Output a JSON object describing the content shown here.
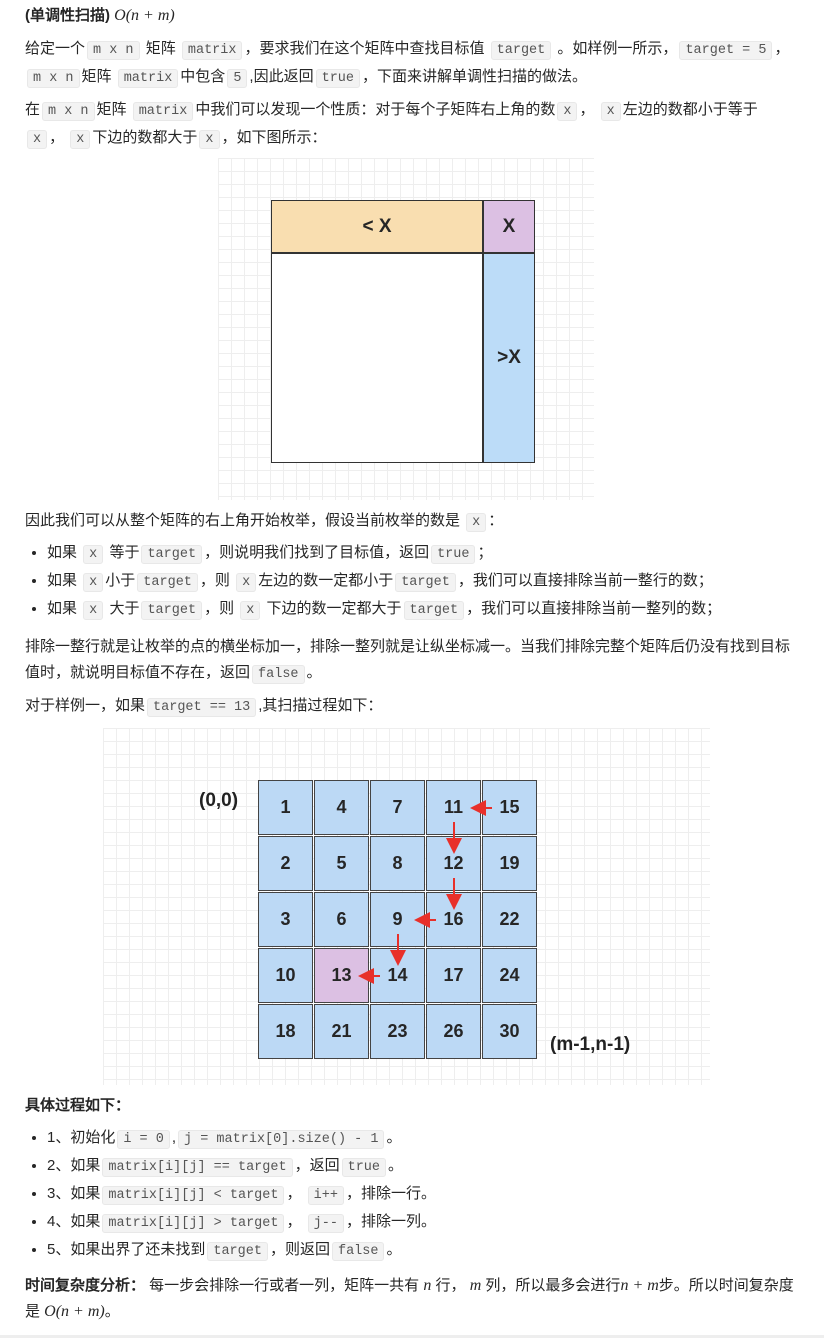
{
  "title": {
    "label": "(单调性扫描)",
    "math": "O(n + m)"
  },
  "p1": [
    {
      "t": "给定一个"
    },
    {
      "c": "m x n"
    },
    {
      "t": " 矩阵 "
    },
    {
      "c": "matrix"
    },
    {
      "t": "，要求我们在这个矩阵中查找目标值 "
    },
    {
      "c": "target"
    },
    {
      "t": " 。如样例一所示，"
    },
    {
      "c": "target = 5"
    },
    {
      "t": "， "
    },
    {
      "c": "m x n"
    },
    {
      "t": "矩阵 "
    },
    {
      "c": "matrix"
    },
    {
      "t": "中包含"
    },
    {
      "c": "5"
    },
    {
      "t": ",因此返回"
    },
    {
      "c": "true"
    },
    {
      "t": "，下面来讲解单调性扫描的做法。"
    }
  ],
  "p2": [
    {
      "t": "在"
    },
    {
      "c": "m x n"
    },
    {
      "t": "矩阵 "
    },
    {
      "c": "matrix"
    },
    {
      "t": "中我们可以发现一个性质：对于每个子矩阵右上角的数"
    },
    {
      "c": "x"
    },
    {
      "t": "， "
    },
    {
      "c": "x"
    },
    {
      "t": "左边的数都小于等于"
    },
    {
      "c": "x"
    },
    {
      "t": "， "
    },
    {
      "c": "x"
    },
    {
      "t": "下边的数都大于"
    },
    {
      "c": "x"
    },
    {
      "t": "，如下图所示："
    }
  ],
  "fig1": {
    "left": "< X",
    "corner": "X",
    "below": ">X",
    "colors": {
      "left": "#f9deb0",
      "corner": "#dcc0e3",
      "below": "#bcdcf8"
    }
  },
  "p3": [
    {
      "t": "因此我们可以从整个矩阵的右上角开始枚举，假设当前枚举的数是 "
    },
    {
      "c": "x"
    },
    {
      "t": "："
    }
  ],
  "list1": [
    [
      {
        "t": "如果 "
      },
      {
        "c": "x"
      },
      {
        "t": " 等于"
      },
      {
        "c": "target"
      },
      {
        "t": "，则说明我们找到了目标值，返回"
      },
      {
        "c": "true"
      },
      {
        "t": "；"
      }
    ],
    [
      {
        "t": "如果 "
      },
      {
        "c": "x"
      },
      {
        "t": "小于"
      },
      {
        "c": "target"
      },
      {
        "t": "，则 "
      },
      {
        "c": "x"
      },
      {
        "t": "左边的数一定都小于"
      },
      {
        "c": "target"
      },
      {
        "t": "，我们可以直接排除当前一整行的数；"
      }
    ],
    [
      {
        "t": "如果 "
      },
      {
        "c": " x"
      },
      {
        "t": " 大于"
      },
      {
        "c": "target"
      },
      {
        "t": "，则 "
      },
      {
        "c": "x"
      },
      {
        "t": " 下边的数一定都大于"
      },
      {
        "c": "target"
      },
      {
        "t": "，我们可以直接排除当前一整列的数；"
      }
    ]
  ],
  "p4": [
    {
      "t": "排除一整行就是让枚举的点的横坐标加一，排除一整列就是让纵坐标减一。当我们排除完整个矩阵后仍没有找到目标值时，就说明目标值不存在，返回"
    },
    {
      "c": "false"
    },
    {
      "t": "。"
    }
  ],
  "p5": [
    {
      "t": "对于样例一，如果"
    },
    {
      "c": "target == 13"
    },
    {
      "t": ",其扫描过程如下："
    }
  ],
  "fig2": {
    "start_label": "(0,0)",
    "end_label": "(m-1,n-1)",
    "matrix": [
      [
        "1",
        "4",
        "7",
        "11",
        "15"
      ],
      [
        "2",
        "5",
        "8",
        "12",
        "19"
      ],
      [
        "3",
        "6",
        "9",
        "16",
        "22"
      ],
      [
        "10",
        "13",
        "14",
        "17",
        "24"
      ],
      [
        "18",
        "21",
        "23",
        "26",
        "30"
      ]
    ],
    "highlight": "13",
    "cell_color": "#bcd9f5",
    "highlight_color": "#dcc0e3",
    "arrow_color": "#e8302a"
  },
  "p6": "具体过程如下：",
  "list2": [
    [
      {
        "t": "1、初始化"
      },
      {
        "c": "i = 0"
      },
      {
        "t": ","
      },
      {
        "c": "j = matrix[0].size() - 1"
      },
      {
        "t": "。"
      }
    ],
    [
      {
        "t": "2、如果"
      },
      {
        "c": "matrix[i][j] == target"
      },
      {
        "t": "，返回"
      },
      {
        "c": "true"
      },
      {
        "t": "。"
      }
    ],
    [
      {
        "t": "3、如果"
      },
      {
        "c": "matrix[i][j] < target"
      },
      {
        "t": "， "
      },
      {
        "c": "i++"
      },
      {
        "t": "，排除一行。"
      }
    ],
    [
      {
        "t": "4、如果"
      },
      {
        "c": "matrix[i][j] > target"
      },
      {
        "t": "， "
      },
      {
        "c": "j--"
      },
      {
        "t": "，排除一列。"
      }
    ],
    [
      {
        "t": "5、如果出界了还未找到"
      },
      {
        "c": "target"
      },
      {
        "t": "，则返回"
      },
      {
        "c": "false"
      },
      {
        "t": "。"
      }
    ]
  ],
  "p7": [
    {
      "b": "时间复杂度分析："
    },
    {
      "t": " 每一步会排除一行或者一列，矩阵一共有 "
    },
    {
      "m": "n"
    },
    {
      "t": " 行， "
    },
    {
      "m": "m"
    },
    {
      "t": " 列，所以最多会进行"
    },
    {
      "m": "n + m"
    },
    {
      "t": "步。所以时间复杂度是 "
    },
    {
      "m": "O(n + m)"
    },
    {
      "t": "。"
    }
  ]
}
